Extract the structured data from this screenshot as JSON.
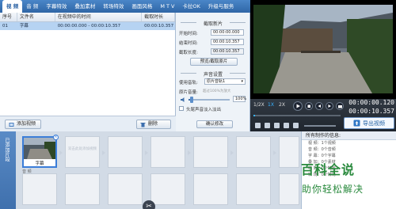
{
  "menu": {
    "items": [
      "视 频",
      "音 频",
      "字幕特效",
      "叠加素材",
      "转场特效",
      "画面风格",
      "M T V",
      "卡拉OK",
      "升级与服务"
    ]
  },
  "clip_list": {
    "columns": [
      "序号",
      "文件名",
      "在视频中的时间",
      "截取时长"
    ],
    "rows": [
      {
        "index": "01",
        "name": "字幕",
        "position": "00:00:00.000 - 00:00:10.357",
        "duration": "00:00:10.357"
      }
    ]
  },
  "buttons": {
    "add_video": "添加视频",
    "delete": "删除"
  },
  "clip_settings": {
    "title": "截取新片",
    "start_label": "开始时间:",
    "start_value": "00:00:00.000",
    "end_label": "结束时间:",
    "end_value": "00:00:10.357",
    "length_label": "截取长度:",
    "length_value": "00:00:10.357",
    "preview_btn": "预览/截取原片",
    "audio_title": "声音设置",
    "track_label": "使用音轨:",
    "track_value": "原片音轨1",
    "volume_label": "原片音量:",
    "volume_hint": "超过100%为放大",
    "volume_value": "100%",
    "fade_label": "头尾声音淡入淡出",
    "confirm_btn": "确认修改"
  },
  "playback": {
    "speeds": [
      "1/2X",
      "1X",
      "2X"
    ],
    "timecode_current": "00:00:00.120",
    "timecode_total": "00:00:10.357",
    "export_label": "导出视频"
  },
  "timeline": {
    "track_label": "已添加片段",
    "clip_label": "字幕",
    "hint_text": "双击此处添加视频",
    "audio_section": "音 频"
  },
  "info": {
    "title": "所有制作的信息:",
    "rows": [
      "视 频：1个视频",
      "音 频：0个音频",
      "字 幕：0个字幕",
      "叠 加：0个素材",
      "特 效：0个特效",
      "转 场：0个转场"
    ]
  },
  "watermark": {
    "big": "百科全说",
    "small": "助你轻松解决"
  },
  "colors": {
    "accent": "#2f66a6",
    "selection": "#b6d3f2",
    "watermark": "#2a8a3e"
  }
}
